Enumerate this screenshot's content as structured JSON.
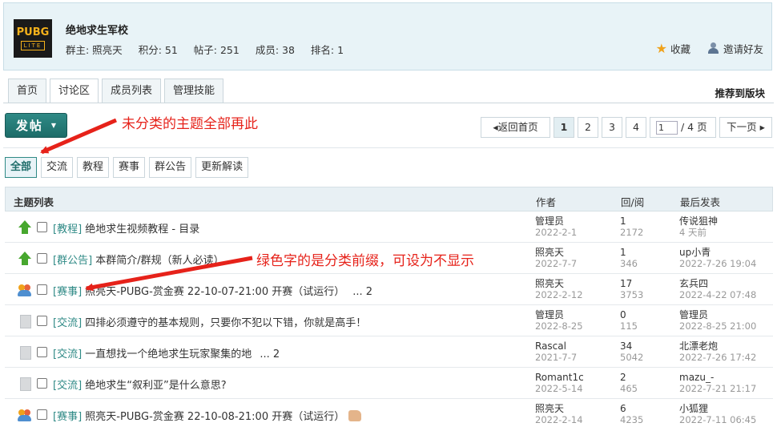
{
  "group": {
    "logo_top": "PUBG",
    "logo_bottom": "LITE",
    "name": "绝地求生军校",
    "owner": "群主: 照亮天",
    "points": "积分: 51",
    "posts": "帖子: 251",
    "members": "成员: 38",
    "rank": "排名: 1",
    "favorite": "收藏",
    "invite": "邀请好友"
  },
  "tabs": [
    "首页",
    "讨论区",
    "成员列表",
    "管理技能"
  ],
  "recommend": "推荐到版块",
  "post_button": "发帖",
  "annotations": {
    "a1": "未分类的主题全部再此",
    "a2": "绿色字的是分类前缀，可设为不显示"
  },
  "pager": {
    "back": "返回首页",
    "pages": [
      "1",
      "2",
      "3",
      "4"
    ],
    "input_value": "1",
    "total": "/ 4 页",
    "next": "下一页"
  },
  "categories": [
    "全部",
    "交流",
    "教程",
    "赛事",
    "群公告",
    "更新解读"
  ],
  "table": {
    "headers": {
      "title": "主题列表",
      "author": "作者",
      "stats": "回/阅",
      "last": "最后发表"
    },
    "rows": [
      {
        "icon": "pinned-up-icon",
        "prefix": "[教程]",
        "title": "绝地求生视频教程 - 目录",
        "more": "",
        "author": "管理员",
        "date": "2022-2-1",
        "replies": "1",
        "views": "2172",
        "last_user": "传说狙神",
        "last_time": "4 天前"
      },
      {
        "icon": "pinned-up-icon",
        "prefix": "[群公告]",
        "title": "本群简介/群规（新人必读）",
        "more": "",
        "author": "照亮天",
        "date": "2022-7-7",
        "replies": "1",
        "views": "346",
        "last_user": "up小青",
        "last_time": "2022-7-26 19:04"
      },
      {
        "icon": "group-icon",
        "prefix": "[赛事]",
        "title": "照亮天-PUBG-赏金赛 22-10-07-21:00 开赛（试运行）",
        "more": "... 2",
        "author": "照亮天",
        "date": "2022-2-12",
        "replies": "17",
        "views": "3753",
        "last_user": "玄兵四",
        "last_time": "2022-4-22 07:48"
      },
      {
        "icon": "document-icon",
        "prefix": "[交流]",
        "title": "四排必须遵守的基本规则，只要你不犯以下错，你就是高手！",
        "more": "",
        "author": "管理员",
        "date": "2022-8-25",
        "replies": "0",
        "views": "115",
        "last_user": "管理员",
        "last_time": "2022-8-25 21:00"
      },
      {
        "icon": "document-icon",
        "prefix": "[交流]",
        "title": "一直想找一个绝地求生玩家聚集的地",
        "more": "... 2",
        "author": "Rascal",
        "date": "2021-7-7",
        "replies": "34",
        "views": "5042",
        "last_user": "北漂老炮",
        "last_time": "2022-7-26 17:42"
      },
      {
        "icon": "document-icon",
        "prefix": "[交流]",
        "title": "绝地求生“叙利亚”是什么意思?",
        "more": "",
        "author": "Romant1c",
        "date": "2022-5-14",
        "replies": "2",
        "views": "465",
        "last_user": "mazu_-",
        "last_time": "2022-7-21 21:17"
      },
      {
        "icon": "group-icon",
        "prefix": "[赛事]",
        "title": "照亮天-PUBG-赏金赛 22-10-08-21:00 开赛（试运行）",
        "more": "",
        "author": "照亮天",
        "date": "2022-2-14",
        "replies": "6",
        "views": "4235",
        "last_user": "小狐狸",
        "last_time": "2022-7-11 06:45"
      }
    ]
  }
}
